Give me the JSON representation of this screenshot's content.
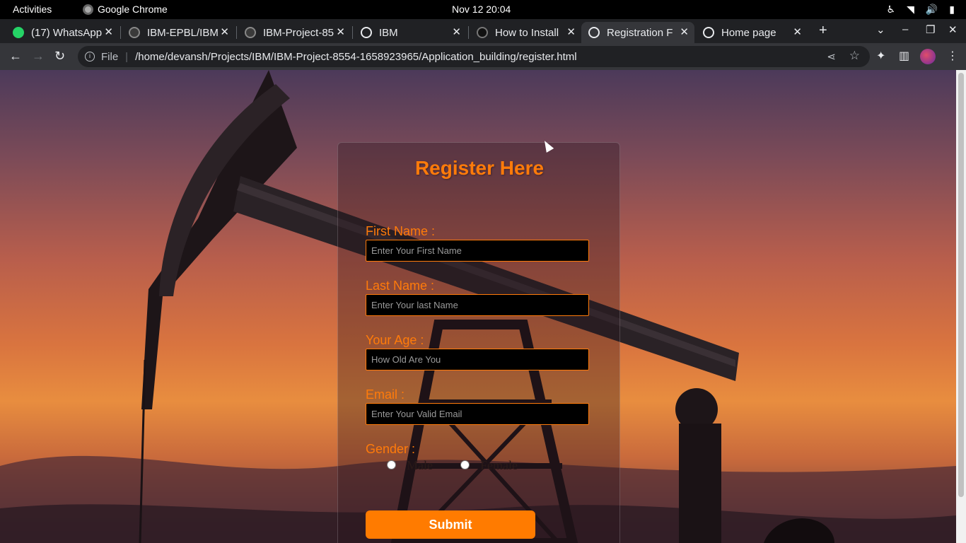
{
  "topbar": {
    "activities": "Activities",
    "app_name": "Google Chrome",
    "clock": "Nov 12  20:04"
  },
  "tabs": [
    {
      "label": "(17) WhatsApp",
      "icon": "whatsapp-icon",
      "color": "#25d366"
    },
    {
      "label": "IBM-EPBL/IBM",
      "icon": "github-icon",
      "color": "#3a3a3a"
    },
    {
      "label": "IBM-Project-85",
      "icon": "github-icon",
      "color": "#3a3a3a"
    },
    {
      "label": "IBM",
      "icon": "globe-icon",
      "color": "#e8eaed"
    },
    {
      "label": "How to Install",
      "icon": "hexagon-icon",
      "color": "#111111"
    },
    {
      "label": "Registration F",
      "icon": "globe-icon",
      "color": "#e8eaed",
      "active": true
    },
    {
      "label": "Home page",
      "icon": "globe-icon",
      "color": "#e8eaed"
    }
  ],
  "address": {
    "scheme_label": "File",
    "url": "/home/devansh/Projects/IBM/IBM-Project-8554-1658923965/Application_building/register.html"
  },
  "form": {
    "title": "Register Here",
    "first_name_label": "First Name :",
    "first_name_placeholder": "Enter Your First Name",
    "last_name_label": "Last Name :",
    "last_name_placeholder": "Enter Your last Name",
    "age_label": "Your Age :",
    "age_placeholder": "How Old Are You",
    "email_label": "Email :",
    "email_placeholder": "Enter Your Valid Email",
    "gender_label": "Gender :",
    "male_label": "Male",
    "female_label": "Female",
    "submit_label": "Submit"
  },
  "colors": {
    "accent": "#ff7b0a",
    "button": "#ff7b00"
  }
}
